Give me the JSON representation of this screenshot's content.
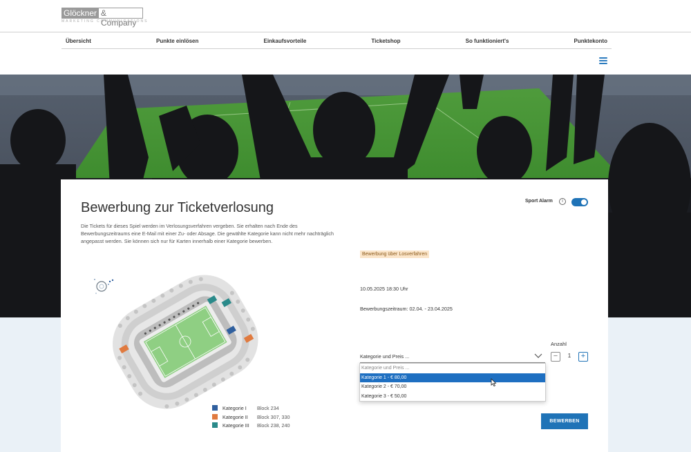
{
  "logo": {
    "part1": "Glöckner",
    "part2": "& Company",
    "tagline": "MARKETING COMMUNICATIONS"
  },
  "nav": [
    "Übersicht",
    "Punkte einlösen",
    "Einkaufsvorteile",
    "Ticketshop",
    "So funktioniert's",
    "Punktekonto"
  ],
  "card": {
    "title": "Bewerbung zur Ticketverlosung",
    "description": "Die Tickets für dieses Spiel werden im Verlosungsverfahren vergeben. Sie erhalten nach Ende des Bewerbungszeitraums eine E-Mail mit einer Zu- oder Absage. Die gewählte Kategorie kann nicht mehr nachträglich angepasst werden. Sie können sich nur für Karten innerhalb einer Kategorie bewerben.",
    "sport_alarm": "Sport Alarm",
    "sport_alarm_on": true,
    "badge": "Bewerbung über Losverfahren",
    "date": "10.05.2025 18:30 Uhr",
    "period": "Bewerbungszeitraum: 02.04. - 23.04.2025",
    "select_value": "Kategorie und Preis ...",
    "options": [
      "Kategorie und Preis ...",
      "Kategorie 1 - € 80,00",
      "Kategorie 2 - € 70,00",
      "Kategorie 3 - € 50,00"
    ],
    "selected_index": 1,
    "anzahl_label": "Anzahl",
    "quantity": "1",
    "minus": "−",
    "plus": "+",
    "apply_label": "BEWERBEN"
  },
  "legend": [
    {
      "name": "Kategorie I",
      "block": "Block 234",
      "color": "#2f5f9e"
    },
    {
      "name": "Kategorie II",
      "block": "Block 307, 330",
      "color": "#e07a3f"
    },
    {
      "name": "Kategorie III",
      "block": "Block 238, 240",
      "color": "#2a8a8a"
    }
  ],
  "colors": {
    "accent": "#1f73b7",
    "selected": "#1e6fc1",
    "badge_bg": "#fbe5c9"
  }
}
